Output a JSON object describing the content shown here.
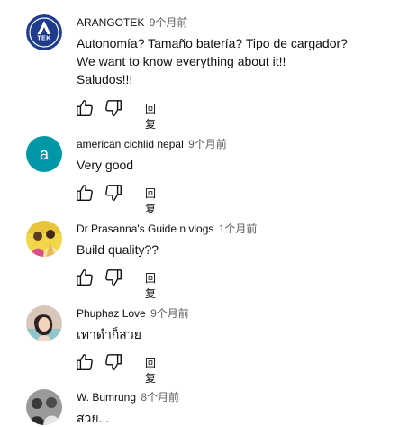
{
  "comments": [
    {
      "author": "ARANGOTEK",
      "time": "9个月前",
      "text": "Autonomía? Tamaño batería? Tipo de cargador?\nWe want to know everything about it!!\nSaludos!!!",
      "avatar": {
        "type": "logo",
        "letter": "A",
        "label": "TEK",
        "bg": "#1f3c8c"
      },
      "reply": "回复"
    },
    {
      "author": "american cichlid nepal",
      "time": "9个月前",
      "text": "Very good",
      "avatar": {
        "type": "letter",
        "letter": "a",
        "bg": "#0097a7"
      },
      "reply": "回复"
    },
    {
      "author": "Dr Prasanna's Guide n vlogs",
      "time": "1个月前",
      "text": "Build quality??",
      "avatar": {
        "type": "photo",
        "bg": "#f2d64a"
      },
      "reply": "回复"
    },
    {
      "author": "Phuphaz Love",
      "time": "9个月前",
      "text": "เทาดำก็สวย",
      "avatar": {
        "type": "photo",
        "bg": "#d8c7b8"
      },
      "reply": "回复"
    },
    {
      "author": "W. Bumrung",
      "time": "8个月前",
      "text": "สวย...",
      "avatar": {
        "type": "photo",
        "bg": "#6b6b6b"
      },
      "reply": ""
    }
  ]
}
